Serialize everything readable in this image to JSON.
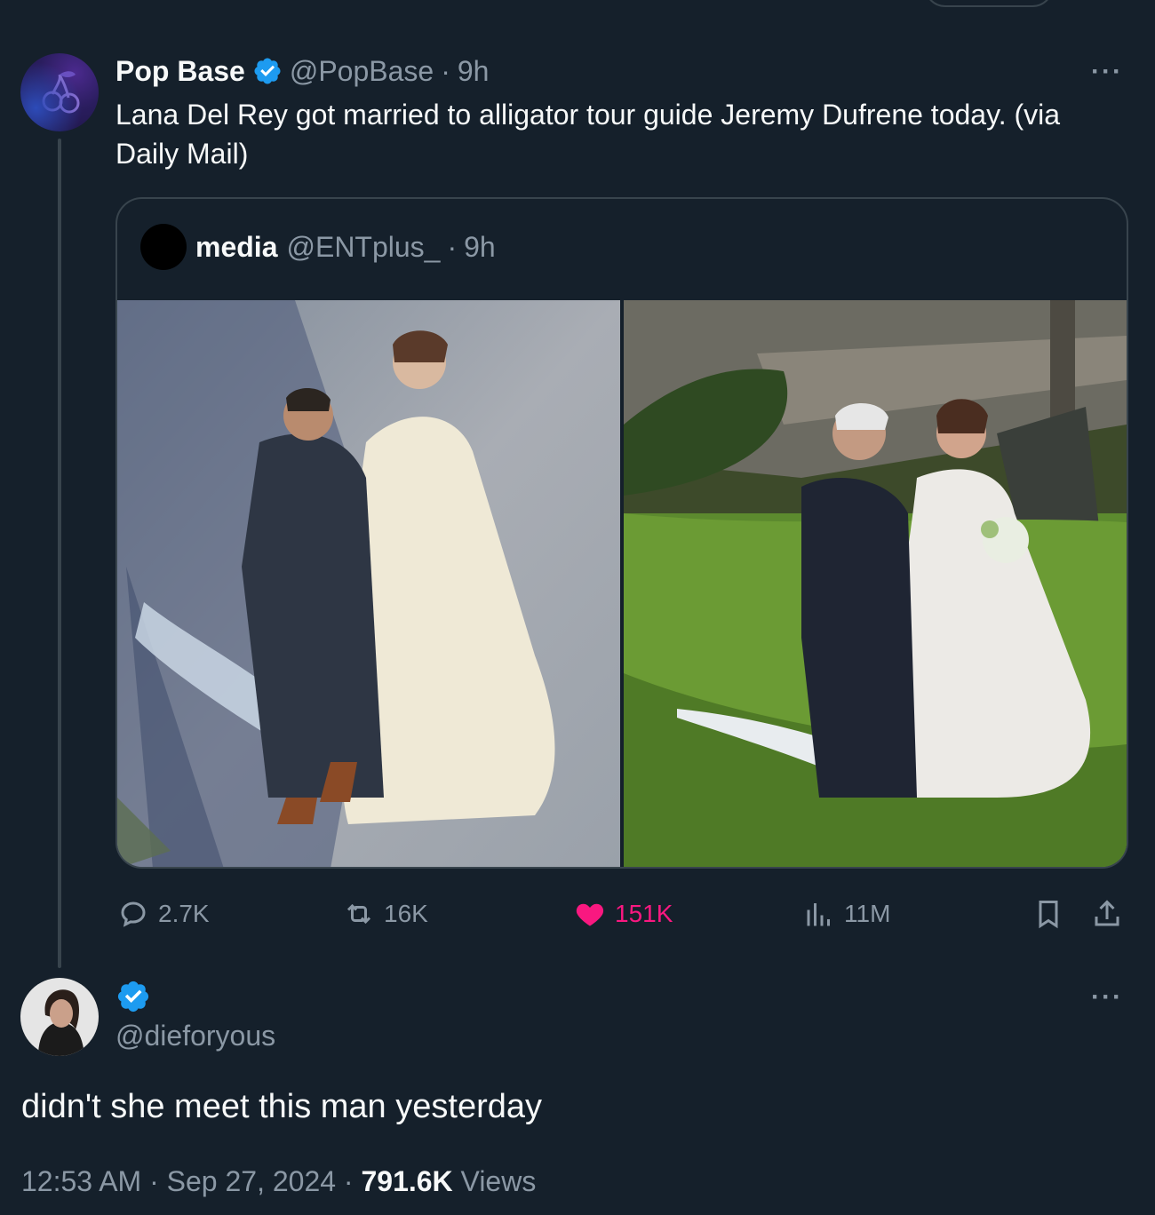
{
  "parent_tweet": {
    "author_name": "Pop Base",
    "handle": "@PopBase",
    "separator": "·",
    "time": "9h",
    "text": "Lana Del Rey got married to alligator tour guide Jeremy Dufrene today. (via Daily Mail)",
    "more_label": "···",
    "quoted": {
      "author_name": "media",
      "handle": "@ENTplus_",
      "separator": "·",
      "time": "9h"
    },
    "actions": {
      "replies": "2.7K",
      "reposts": "16K",
      "likes": "151K",
      "views": "11M"
    }
  },
  "reply_tweet": {
    "handle": "@dieforyous",
    "text": "didn't she meet this man yesterday",
    "more_label": "···",
    "time": "12:53 AM",
    "separator1": "·",
    "date": "Sep 27, 2024",
    "separator2": "·",
    "views_count": "791.6K",
    "views_label": "Views"
  },
  "colors": {
    "background": "#15202b",
    "text_primary": "#f7f9f9",
    "text_secondary": "#8b98a5",
    "border": "#38444d",
    "verified_blue": "#1d9bf0",
    "like_pink": "#f91880"
  },
  "icons": [
    "verified-badge-icon",
    "reply-icon",
    "repost-icon",
    "heart-icon",
    "views-icon",
    "bookmark-icon",
    "share-icon",
    "more-icon"
  ]
}
